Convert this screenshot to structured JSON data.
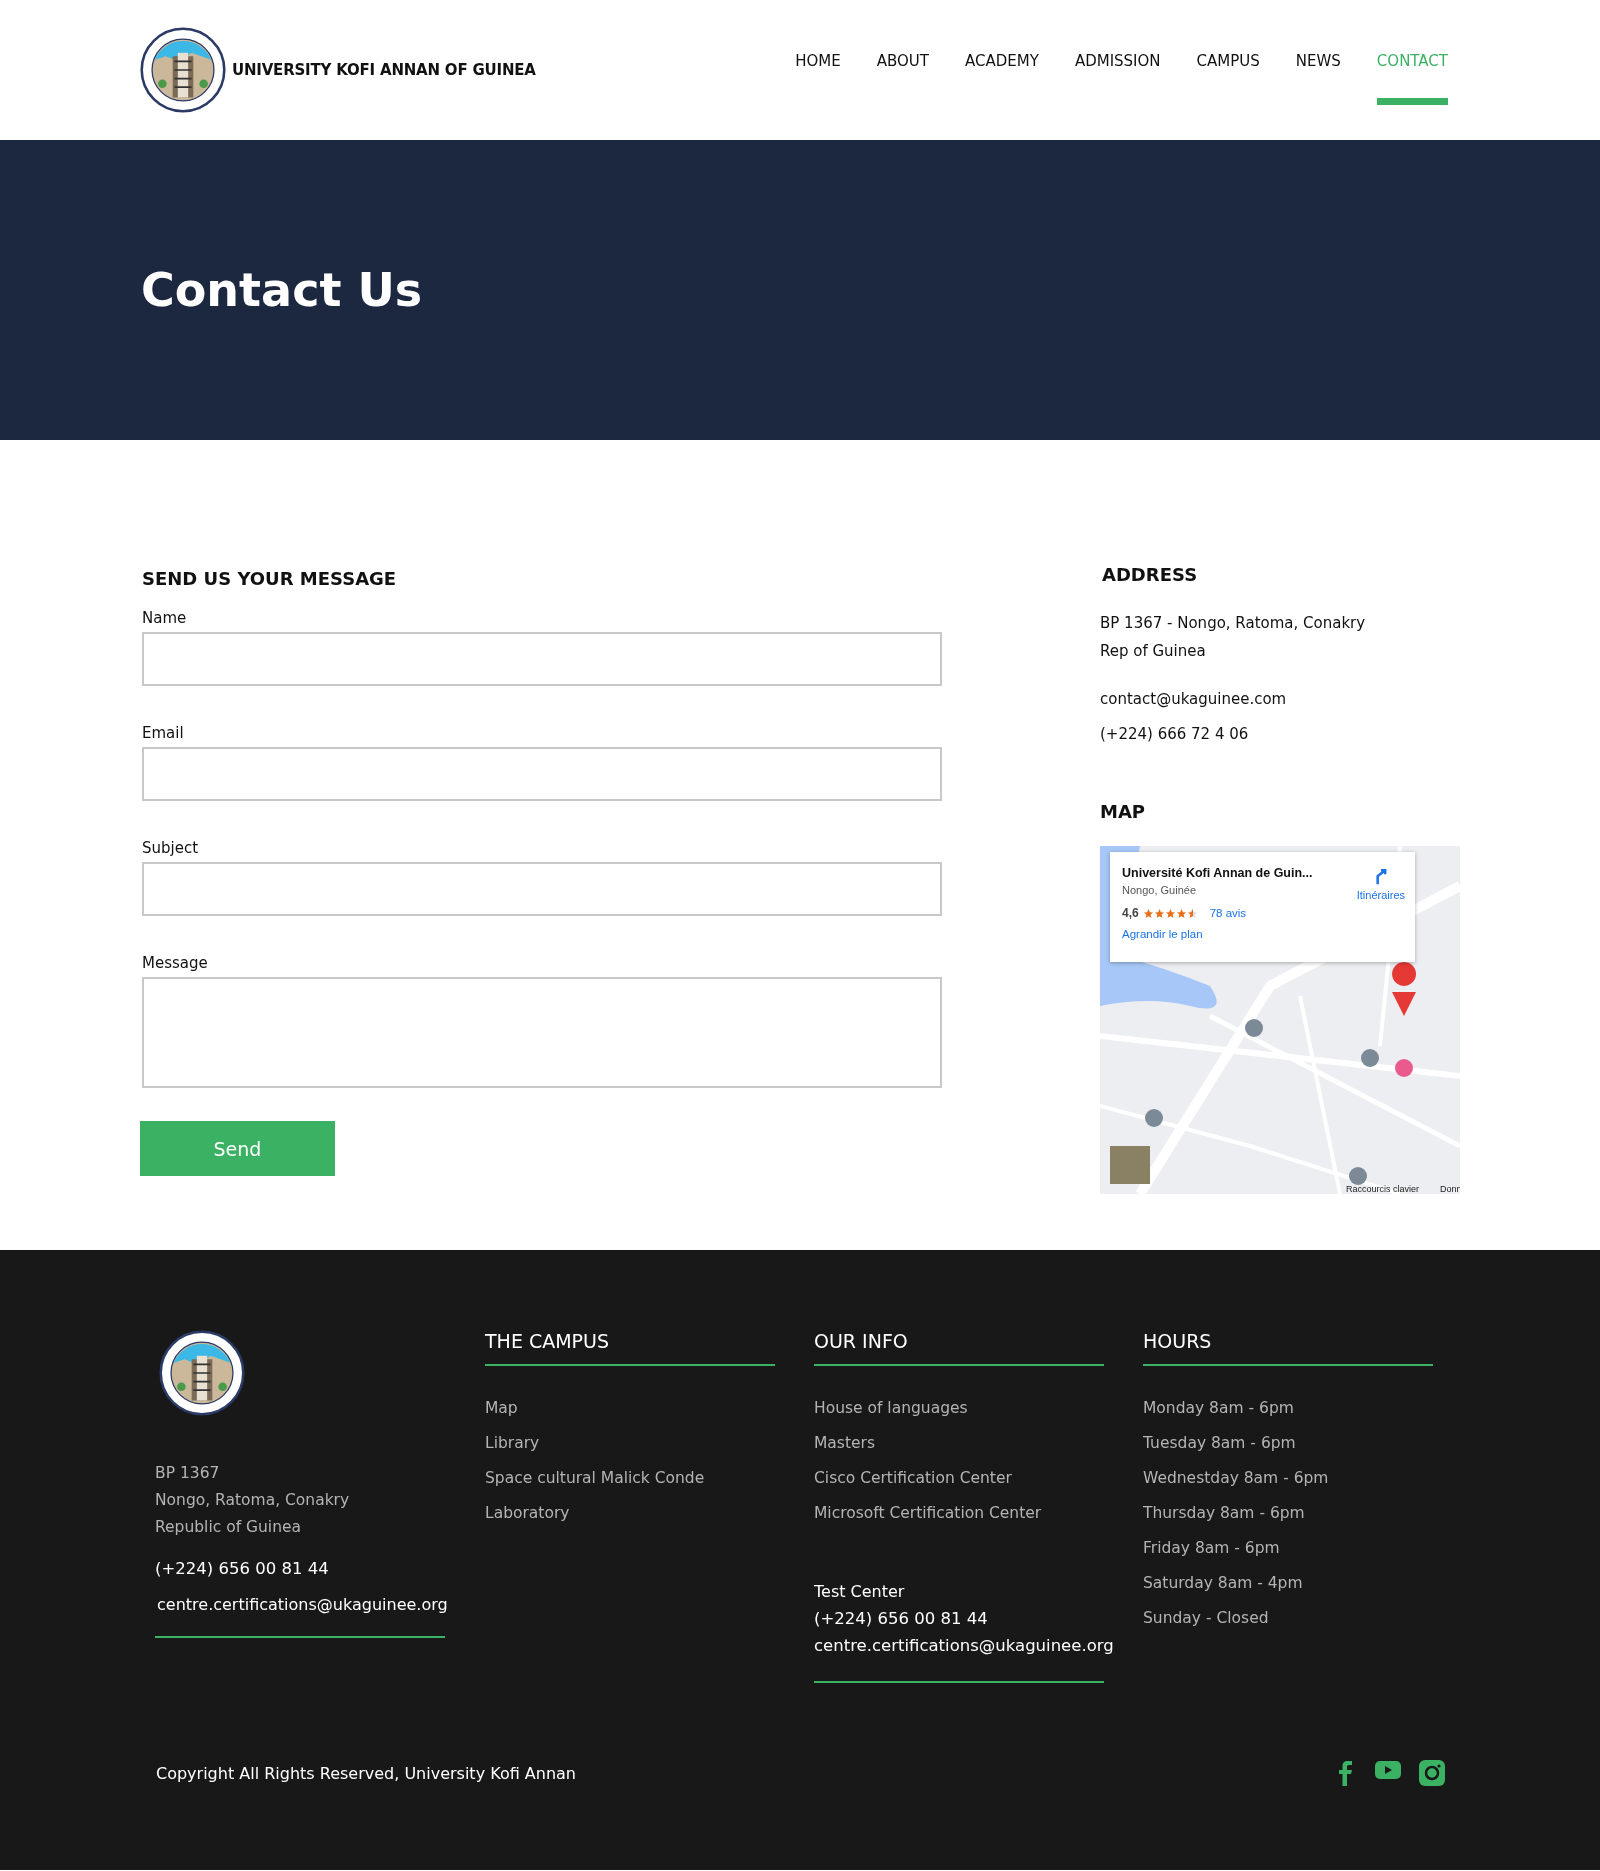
{
  "header": {
    "brand": "UNIVERSITY KOFI ANNAN OF GUINEA",
    "nav": [
      {
        "label": "HOME",
        "selected": false
      },
      {
        "label": "ABOUT",
        "selected": false
      },
      {
        "label": "ACADEMY",
        "selected": false
      },
      {
        "label": "ADMISSION",
        "selected": false
      },
      {
        "label": "CAMPUS",
        "selected": false
      },
      {
        "label": "NEWS",
        "selected": false
      },
      {
        "label": "CONTACT",
        "selected": true
      }
    ]
  },
  "hero": {
    "title": "Contact Us"
  },
  "form": {
    "title": "SEND US YOUR MESSAGE",
    "fields": [
      {
        "label": "Name",
        "kind": "input"
      },
      {
        "label": "Email",
        "kind": "input"
      },
      {
        "label": "Subject",
        "kind": "input"
      },
      {
        "label": "Message",
        "kind": "textarea"
      }
    ],
    "submit": "Send"
  },
  "address": {
    "title": "ADDRESS",
    "lines": [
      "BP 1367 - Nongo, Ratoma, Conakry",
      "Rep of Guinea"
    ],
    "email": "contact@ukaguinee.com",
    "phone": "(+224) 666 72 4 06"
  },
  "map": {
    "title": "MAP",
    "card": {
      "name": "Université Kofi Annan de Guin...",
      "place": "Nongo, Guinée",
      "rating": "4,6",
      "stars": 4.5,
      "reviews": "78 avis",
      "enlarge": "Agrandir le plan",
      "directions": "Itinéraires"
    },
    "shortcuts": "Raccourcis clavier",
    "data_cut": "Donn"
  },
  "footer": {
    "address": [
      "BP 1367",
      "Nongo, Ratoma, Conakry",
      "Republic of Guinea"
    ],
    "phone": "(+224) 656 00 81 44",
    "email": "centre.certifications@ukaguinee.org",
    "columns": [
      {
        "title": "THE CAMPUS",
        "links": [
          "Map",
          "Library",
          "Space cultural Malick Conde",
          "Laboratory"
        ]
      },
      {
        "title": "OUR INFO",
        "links": [
          "House of languages",
          "Masters",
          "Cisco Certification Center",
          "Microsoft Certification Center"
        ],
        "contact": [
          "Test Center",
          "(+224) 656 00 81 44",
          "centre.certifications@ukaguinee.org"
        ]
      },
      {
        "title": "HOURS",
        "links": [
          "Monday 8am - 6pm",
          "Tuesday 8am - 6pm",
          "Wednestday 8am - 6pm",
          "Thursday 8am - 6pm",
          "Friday 8am - 6pm",
          "Saturday 8am - 4pm",
          "Sunday - Closed"
        ]
      }
    ],
    "copyright": "Copyright All Rights Reserved, University Kofi Annan"
  }
}
